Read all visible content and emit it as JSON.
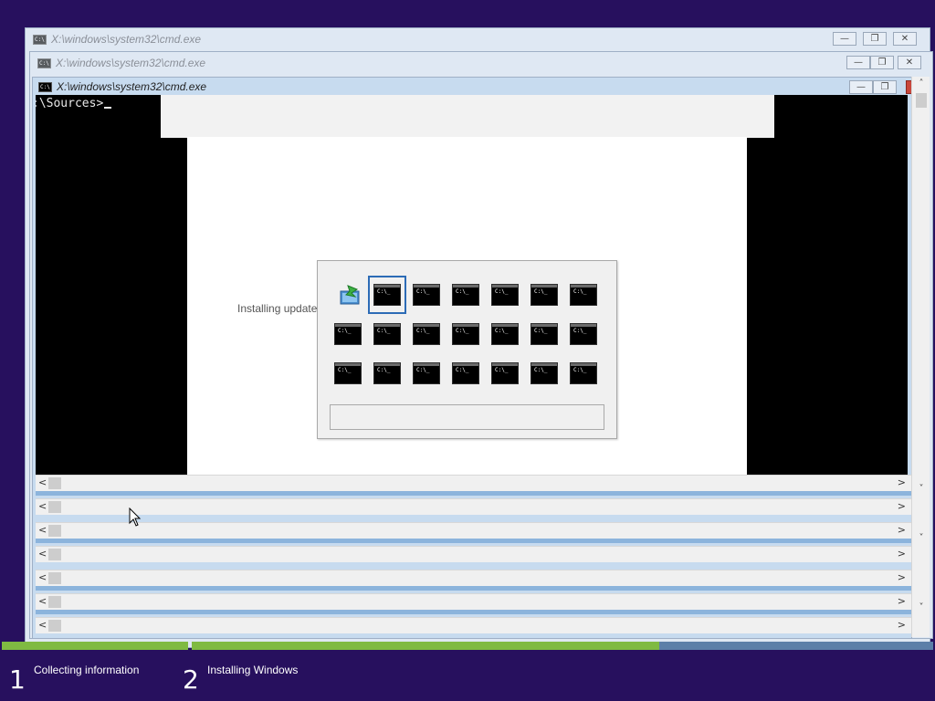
{
  "windows": [
    {
      "title": "X:\\windows\\system32\\cmd.exe",
      "state": "inactive"
    },
    {
      "title": "X:\\windows\\system32\\cmd.exe",
      "state": "inactive"
    },
    {
      "title": "X:\\windows\\system32\\cmd.exe",
      "state": "active"
    }
  ],
  "window_controls": {
    "minimize": "—",
    "restore": "❐",
    "close": "✕"
  },
  "console": {
    "prompt": ":\\Sources>"
  },
  "setup": {
    "status_text": "Installing update"
  },
  "switcher": {
    "tile_caption": "C:\\_",
    "total_tiles": 21,
    "focused_index": 1,
    "first_icon": "windows-setup-icon"
  },
  "scrollbar": {
    "left_arrow": "<",
    "right_arrow": ">",
    "up_arrow": "˄",
    "down_arrow": "˅"
  },
  "progress": {
    "steps": [
      {
        "number": "1",
        "label": "Collecting information"
      },
      {
        "number": "2",
        "label": "Installing Windows"
      }
    ],
    "step2_fraction": 0.63
  },
  "colors": {
    "desktop": "#27105e",
    "progress_done": "#7fba42",
    "progress_track": "#5c7fa8",
    "focus": "#2c6bb6"
  }
}
